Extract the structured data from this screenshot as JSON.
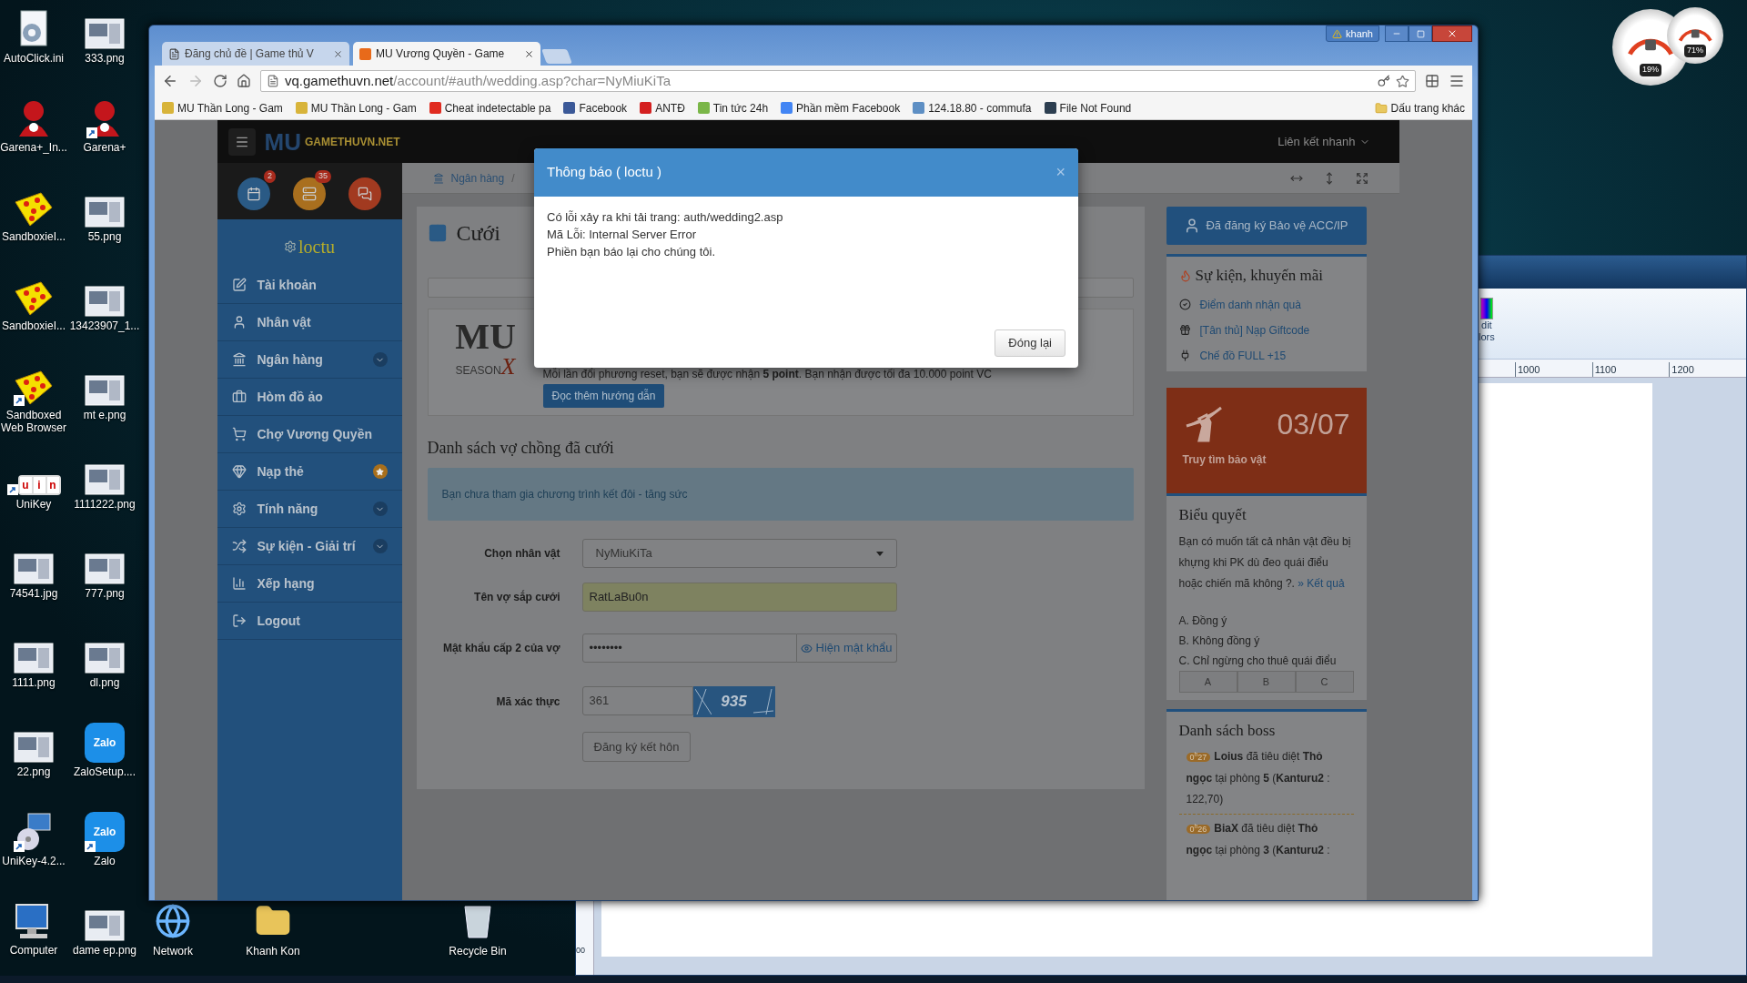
{
  "desktop": {
    "icons": [
      {
        "label": "AutoClick.ini",
        "kind": "file",
        "shortcut": false
      },
      {
        "label": "Garena+_In...",
        "kind": "garena",
        "shortcut": false
      },
      {
        "label": "SandboxieI...",
        "kind": "sandbox",
        "shortcut": false
      },
      {
        "label": "SandboxieI...",
        "kind": "sandbox",
        "shortcut": false
      },
      {
        "label": "Sandboxed Web Browser",
        "kind": "sandbox",
        "shortcut": true
      },
      {
        "label": "UniKey",
        "kind": "unikey",
        "shortcut": true,
        "letters": [
          "u",
          "i",
          "n"
        ]
      },
      {
        "label": "74541.jpg",
        "kind": "image",
        "shortcut": false
      },
      {
        "label": "1111.png",
        "kind": "image",
        "shortcut": false
      },
      {
        "label": "22.png",
        "kind": "image",
        "shortcut": false
      },
      {
        "label": "UniKey-4.2...",
        "kind": "installer",
        "shortcut": true
      },
      {
        "label": "Computer",
        "kind": "computer",
        "shortcut": false
      },
      {
        "label": "333.png",
        "kind": "image",
        "shortcut": false
      },
      {
        "label": "Garena+",
        "kind": "garena",
        "shortcut": true
      },
      {
        "label": "55.png",
        "kind": "image",
        "shortcut": false
      },
      {
        "label": "13423907_1...",
        "kind": "image",
        "shortcut": false
      },
      {
        "label": "mt e.png",
        "kind": "image",
        "shortcut": false
      },
      {
        "label": "1111222.png",
        "kind": "image",
        "shortcut": false
      },
      {
        "label": "777.png",
        "kind": "image",
        "shortcut": false
      },
      {
        "label": "dl.png",
        "kind": "image",
        "shortcut": false
      },
      {
        "label": "ZaloSetup....",
        "kind": "zalo",
        "shortcut": false,
        "logo_text": "Zalo"
      },
      {
        "label": "Zalo",
        "kind": "zalo",
        "shortcut": true,
        "logo_text": "Zalo"
      },
      {
        "label": "dame ep.png",
        "kind": "image",
        "shortcut": false
      }
    ],
    "bottom_icons": [
      {
        "label": "Network",
        "kind": "network"
      },
      {
        "label": "Khanh Kon",
        "kind": "folder"
      },
      {
        "label": "Recycle Bin",
        "kind": "bin"
      }
    ]
  },
  "gadgets": [
    {
      "reading": "19%"
    },
    {
      "reading": "71%"
    }
  ],
  "paint_window": {
    "ribbon_label": [
      "dit",
      "lors"
    ],
    "ruler": [
      "1000",
      "1100",
      "1200"
    ],
    "side_ruler": "00"
  },
  "browser": {
    "profile": "khanh",
    "tabs": [
      {
        "title": "Đăng chủ đề | Game thủ V",
        "selected": false
      },
      {
        "title": "MU Vương Quyền - Game",
        "selected": true
      }
    ],
    "url": {
      "host": "vq.gamethuvn.net",
      "path": "/account/#auth/wedding.asp?char=NyMiuKiTa"
    },
    "bookmarks": [
      "MU Thần Long - Gam",
      "MU Thần Long - Gam",
      "Cheat indetectable pa",
      "Facebook",
      "ANTĐ",
      "Tin tức 24h",
      "Phần mềm Facebook",
      "124.18.80 - commufa",
      "File Not Found"
    ],
    "other_bookmarks": "Dấu trang khác"
  },
  "page": {
    "logo": {
      "backdrop": "MU",
      "text": "GAMETHUVN.NET"
    },
    "quick_links": "Liên kết nhanh",
    "sidebar": {
      "badges": [
        "2",
        "35"
      ],
      "user": "loctu",
      "items": [
        {
          "label": "Tài khoản",
          "kind": "plain"
        },
        {
          "label": "Nhân vật",
          "kind": "plain"
        },
        {
          "label": "Ngân hàng",
          "kind": "submenu"
        },
        {
          "label": "Hòm đồ ảo",
          "kind": "plain"
        },
        {
          "label": "Chợ Vương Quyền",
          "kind": "plain"
        },
        {
          "label": "Nạp thẻ",
          "kind": "starred"
        },
        {
          "label": "Tính năng",
          "kind": "submenu"
        },
        {
          "label": "Sự kiện - Giải trí",
          "kind": "submenu"
        },
        {
          "label": "Xếp hạng",
          "kind": "plain"
        },
        {
          "label": "Logout",
          "kind": "plain"
        }
      ]
    },
    "breadcrumb": [
      "Ngân hàng",
      "/"
    ],
    "title": "Cưới",
    "info": {
      "logo": {
        "text": "MU",
        "season": "SEASON",
        "mark": "X"
      },
      "text": "Mỗi lần đổi phương reset, bạn sẽ được nhận **5 point**. Bạn nhận được tối đa 10.000 point VC",
      "button": "Đọc thêm hướng dẫn"
    },
    "married_heading": "Danh sách vợ chồng đã cưới",
    "alert": "Bạn chưa tham gia chương trình kết đôi - tăng sức",
    "form": [
      {
        "label": "Chọn nhân vật",
        "kind": "select",
        "value": "NyMiuKiTa"
      },
      {
        "label": "Tên vợ sắp cưới",
        "kind": "text",
        "value": "RatLaBu0n"
      },
      {
        "label": "Mật khẩu cấp 2 của vợ",
        "kind": "password",
        "value": "••••••••",
        "button": "Hiện mật khẩu"
      },
      {
        "label": "Mã xác thực",
        "kind": "captcha",
        "value": "361",
        "captcha": "935"
      }
    ],
    "submit": "Đăng ký kết hôn",
    "right": {
      "protect_button": "Đã đăng ký Bảo vệ ACC/IP",
      "events": {
        "title": "Sự kiện, khuyến mãi",
        "links": [
          "Điểm danh nhận quà",
          "[Tân thủ] Nạp Giftcode",
          "Chế đồ FULL +15"
        ]
      },
      "treasure": {
        "date": "03/07",
        "label": "Truy tìm bảo vật"
      },
      "poll": {
        "title": "Biểu quyết",
        "question": "Bạn có muốn tất cả nhân vật đều bị khựng khi PK dù đeo quái điểu hoặc chiến mã không ?.",
        "result_link": "» Kết quả",
        "options": [
          "A. Đồng ý",
          "B. Không đồng ý",
          "C. Chỉ ngừng cho thuê quái điểu"
        ],
        "buttons": [
          "A",
          "B",
          "C"
        ]
      },
      "bosses": {
        "title": "Danh sách boss",
        "entries": [
          {
            "time": "0$^{h}$27",
            "text": "**Loius** đã tiêu diệt **Thỏ ngọc** tại phòng **5** (**Kanturu2** : 122,70)"
          },
          {
            "time": "0$^{h}$26",
            "text": "**BiaX** đã tiêu diệt **Thỏ ngọc** tại phòng **3** (**Kanturu2** :"
          }
        ]
      }
    }
  },
  "modal": {
    "title": "Thông báo ( loctu )",
    "close": "×",
    "lines": [
      "Có lỗi xảy ra khi tải trang: auth/wedding2.asp",
      "Mã Lỗi: Internal Server Error",
      "Phiền bạn báo lại cho chúng tôi."
    ],
    "button": "Đóng lại"
  }
}
